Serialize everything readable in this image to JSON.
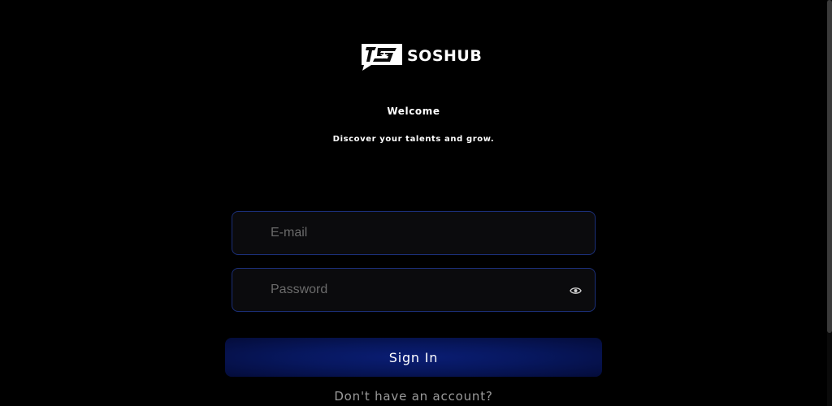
{
  "brand": {
    "name": "SOSHUB",
    "logo_icon": "soshub-logo-icon"
  },
  "header": {
    "title": "Welcome",
    "subtitle": "Discover your talents and grow."
  },
  "form": {
    "email_placeholder": "E-mail",
    "password_placeholder": "Password",
    "password_toggle_icon": "eye-icon",
    "submit_label": "Sign In",
    "signup_prompt": "Don't have an account?"
  },
  "colors": {
    "background": "#000000",
    "field_border": "#1b2f78",
    "button": "#07175e",
    "muted_text": "#9a9a9a"
  }
}
